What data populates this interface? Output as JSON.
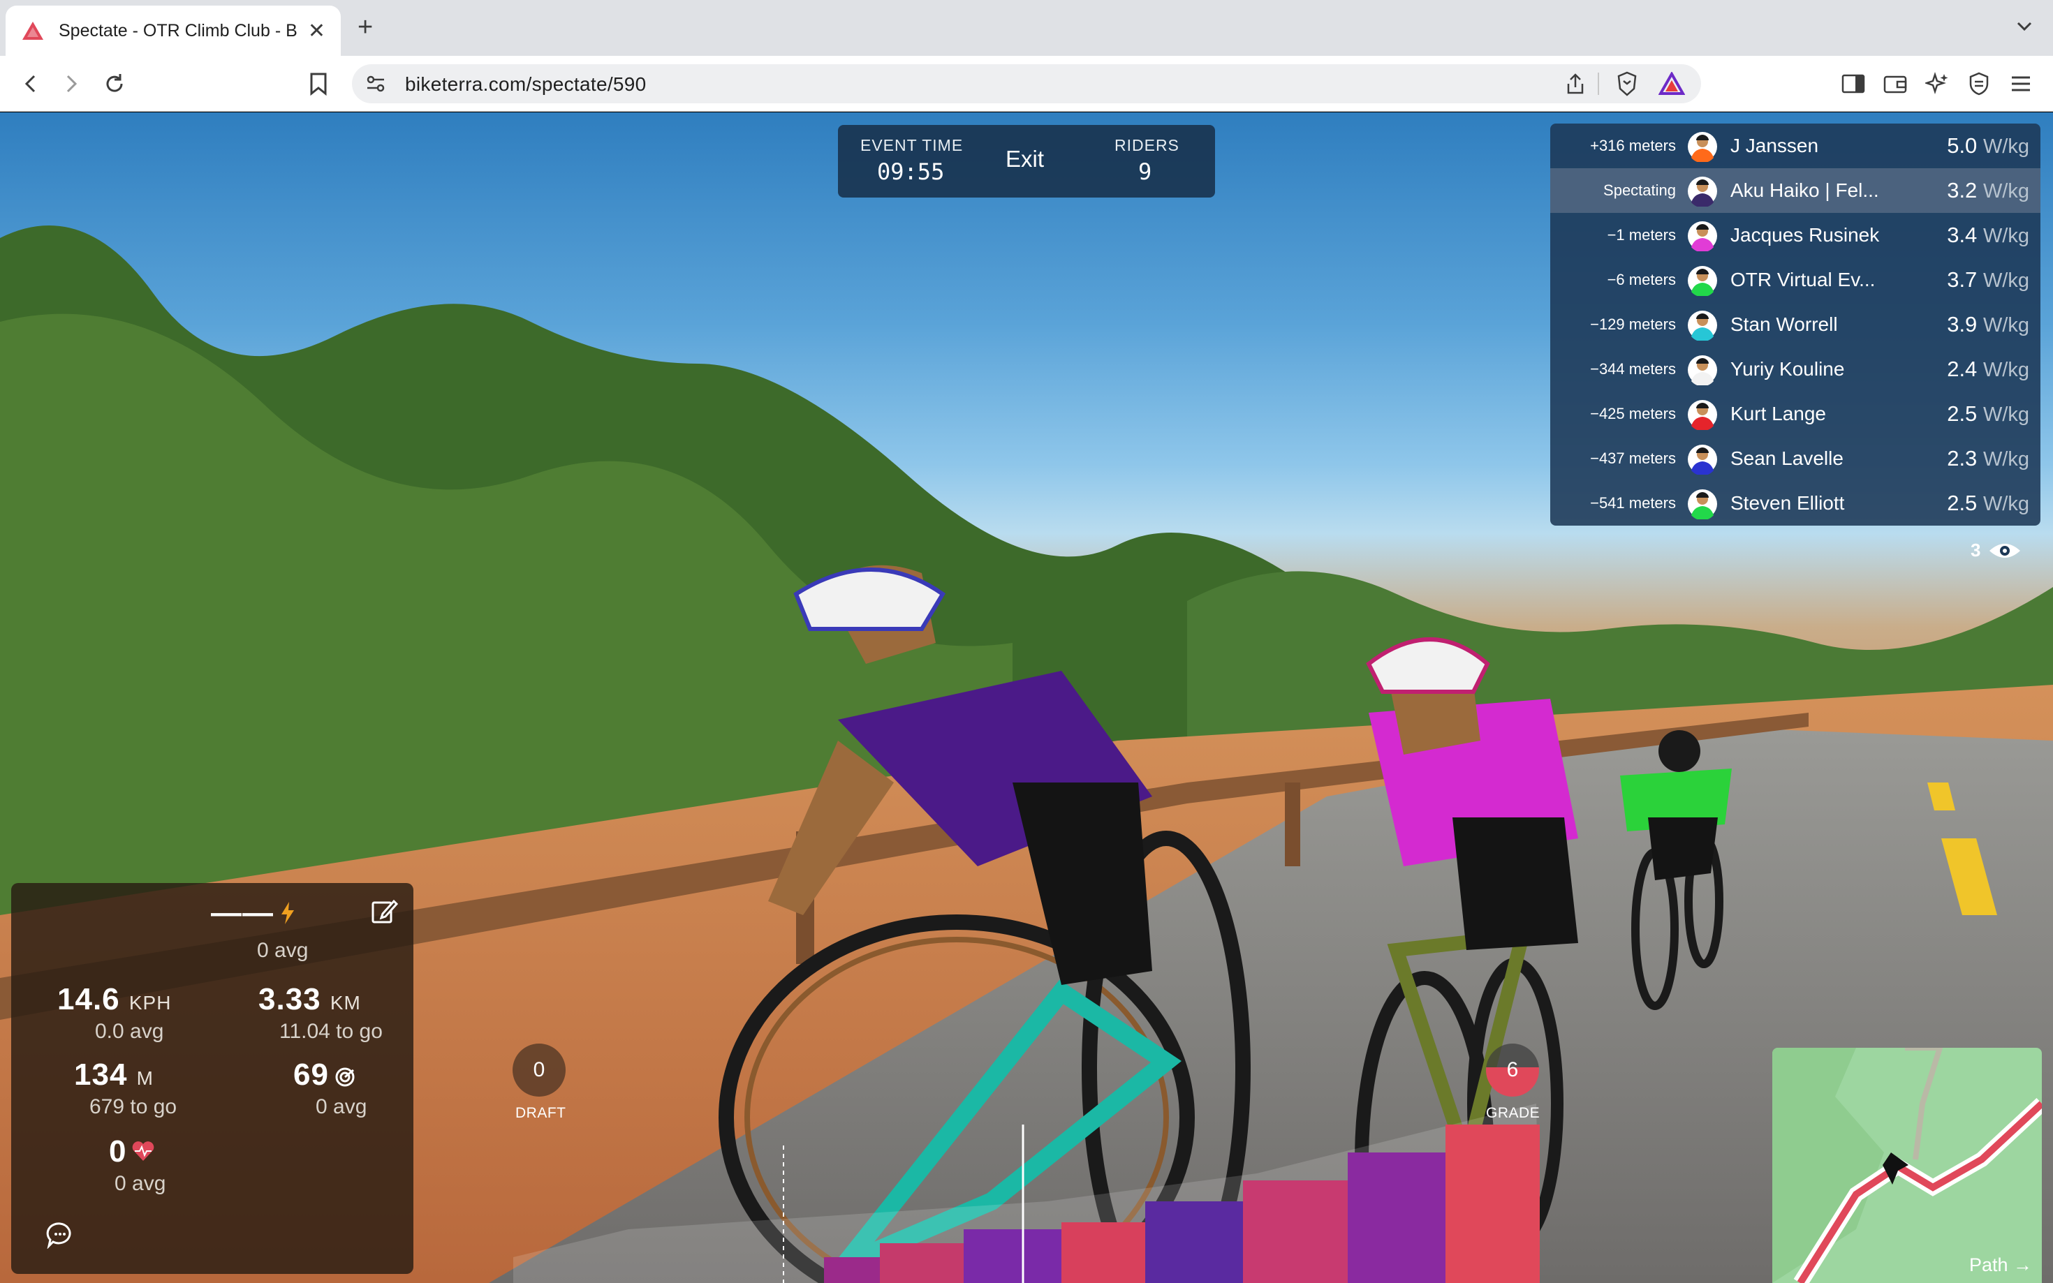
{
  "browser": {
    "tab_title": "Spectate - OTR Climb Club - B",
    "url": "biketerra.com/spectate/590"
  },
  "event": {
    "time_label": "EVENT TIME",
    "time_value": "09:55",
    "exit_label": "Exit",
    "riders_label": "RIDERS",
    "riders_value": "9"
  },
  "leaderboard": [
    {
      "gap": "+316 meters",
      "name": "J Janssen",
      "wkg": "5.0",
      "unit": "W/kg",
      "jersey": "#ff6a1a",
      "active": false
    },
    {
      "gap": "Spectating",
      "name": "Aku Haiko | Fel...",
      "wkg": "3.2",
      "unit": "W/kg",
      "jersey": "#3a2a6a",
      "active": true
    },
    {
      "gap": "−1 meters",
      "name": "Jacques Rusinek",
      "wkg": "3.4",
      "unit": "W/kg",
      "jersey": "#e13cd6",
      "active": false
    },
    {
      "gap": "−6 meters",
      "name": "OTR Virtual Ev...",
      "wkg": "3.7",
      "unit": "W/kg",
      "jersey": "#22d84a",
      "active": false
    },
    {
      "gap": "−129 meters",
      "name": "Stan Worrell",
      "wkg": "3.9",
      "unit": "W/kg",
      "jersey": "#27c6d6",
      "active": false
    },
    {
      "gap": "−344 meters",
      "name": "Yuriy Kouline",
      "wkg": "2.4",
      "unit": "W/kg",
      "jersey": "#f2f2f2",
      "active": false
    },
    {
      "gap": "−425 meters",
      "name": "Kurt Lange",
      "wkg": "2.5",
      "unit": "W/kg",
      "jersey": "#e5242b",
      "active": false
    },
    {
      "gap": "−437 meters",
      "name": "Sean Lavelle",
      "wkg": "2.3",
      "unit": "W/kg",
      "jersey": "#2a33d0",
      "active": false
    },
    {
      "gap": "−541 meters",
      "name": "Steven Elliott",
      "wkg": "2.5",
      "unit": "W/kg",
      "jersey": "#22d84a",
      "active": false
    }
  ],
  "spectator_count": "3",
  "stats": {
    "power_value": "——",
    "power_avg": "0 avg",
    "speed_value": "14.6",
    "speed_unit": "KPH",
    "speed_avg": "0.0 avg",
    "distance_value": "3.33",
    "distance_unit": "KM",
    "distance_togo": "11.04 to go",
    "elevation_value": "134",
    "elevation_unit": "M",
    "elevation_togo": "679 to go",
    "cadence_value": "69",
    "cadence_avg": "0 avg",
    "hr_value": "0",
    "hr_avg": "0 avg"
  },
  "draft": {
    "value": "0",
    "label": "DRAFT"
  },
  "grade": {
    "value": "6",
    "label": "GRADE"
  },
  "minimap": {
    "label": "Path →"
  },
  "colors": {
    "accent_red": "#e0485a",
    "panel_blue": "#1c3856",
    "brave_orange": "#fb542b"
  }
}
